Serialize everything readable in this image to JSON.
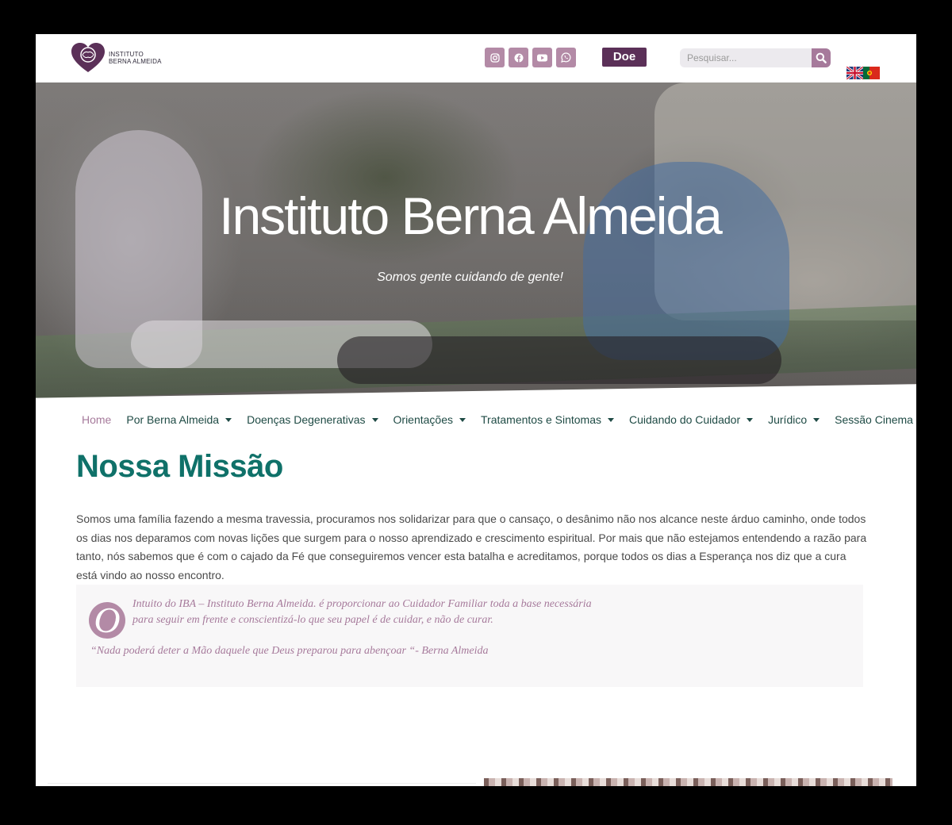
{
  "header": {
    "logo_line1": "INSTITUTO",
    "logo_line2": "BERNA ALMEIDA",
    "social": [
      {
        "name": "instagram-icon"
      },
      {
        "name": "facebook-icon"
      },
      {
        "name": "youtube-icon"
      },
      {
        "name": "whatsapp-icon"
      }
    ],
    "donate_label": "Doe",
    "search_placeholder": "Pesquisar...",
    "languages": [
      "en",
      "pt"
    ]
  },
  "hero": {
    "title": "Instituto Berna Almeida",
    "subtitle": "Somos gente cuidando de gente!"
  },
  "nav": {
    "items": [
      {
        "label": "Home",
        "has_dropdown": false,
        "active": true
      },
      {
        "label": "Por Berna Almeida",
        "has_dropdown": true
      },
      {
        "label": "Doenças Degenerativas",
        "has_dropdown": true
      },
      {
        "label": "Orientações",
        "has_dropdown": true
      },
      {
        "label": "Tratamentos e Sintomas",
        "has_dropdown": true
      },
      {
        "label": "Cuidando do Cuidador",
        "has_dropdown": true
      },
      {
        "label": "Jurídico",
        "has_dropdown": true
      },
      {
        "label": "Sessão Cinema",
        "has_dropdown": true
      }
    ]
  },
  "mission": {
    "title": "Nossa Missão",
    "text": "Somos uma família fazendo a mesma travessia, procuramos nos solidarizar para que o cansaço, o desânimo não nos alcance neste árduo caminho, onde todos os dias nos deparamos com novas lições que surgem para o nosso aprendizado e crescimento espiritual. Por mais que não estejamos entendendo a razão para tanto, nós sabemos que é com o cajado da Fé que conseguiremos vencer esta batalha e acreditamos, porque todos os dias a Esperança nos diz que a cura está vindo ao nosso encontro."
  },
  "quote": {
    "dropcap": "O",
    "line1": "Intuito do IBA – Instituto Berna Almeida. é proporcionar ao Cuidador Familiar toda a base necessária",
    "line2": "para seguir em frente e conscientizá-lo que seu papel é de cuidar, e não de curar.",
    "author_line": "“Nada poderá deter a Mão daquele que Deus preparou para abençoar “- Berna Almeida"
  },
  "colors": {
    "brand_purple": "#5b3058",
    "accent_mauve": "#b38aa6",
    "teal": "#0f7169",
    "nav_text": "#1f4b45"
  }
}
